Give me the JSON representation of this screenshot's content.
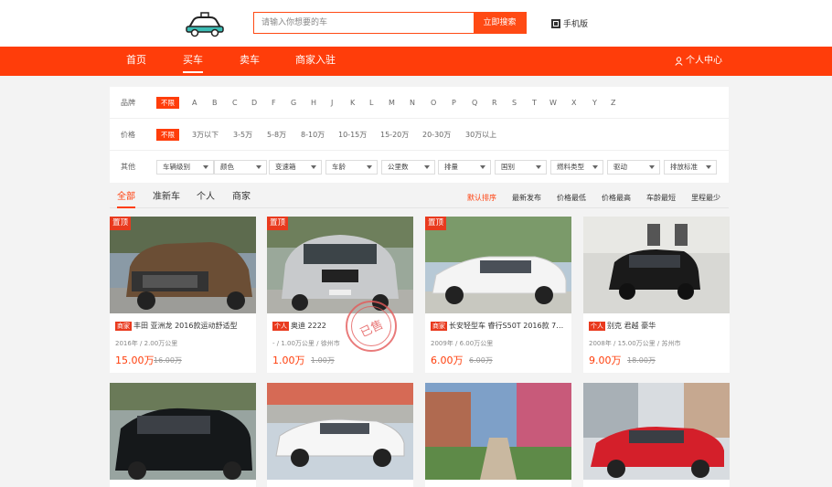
{
  "search": {
    "placeholder": "请输入你想要的车",
    "button": "立即搜索"
  },
  "header": {
    "mobile_label": "手机版"
  },
  "nav": {
    "items": [
      "首页",
      "买车",
      "卖车",
      "商家入驻"
    ],
    "user_center": "个人中心"
  },
  "filters": {
    "brand": {
      "label": "品牌",
      "selected": "不限",
      "letters": [
        "A",
        "B",
        "C",
        "D",
        "F",
        "G",
        "H",
        "J",
        "K",
        "L",
        "M",
        "N",
        "O",
        "P",
        "Q",
        "R",
        "S",
        "T",
        "W",
        "X",
        "Y",
        "Z"
      ]
    },
    "price": {
      "label": "价格",
      "selected": "不限",
      "options": [
        "3万以下",
        "3-5万",
        "5-8万",
        "8-10万",
        "10-15万",
        "15-20万",
        "20-30万",
        "30万以上"
      ]
    },
    "other": {
      "label": "其他",
      "selects": [
        "车辆级别",
        "颜色",
        "变速箱",
        "车龄",
        "公里数",
        "排量",
        "国别",
        "燃料类型",
        "驱动",
        "排放标准"
      ]
    }
  },
  "tabs": {
    "items": [
      "全部",
      "准新车",
      "个人",
      "商家"
    ]
  },
  "sort": {
    "items": [
      "默认排序",
      "最新发布",
      "价格最低",
      "价格最高",
      "车龄最短",
      "里程最少"
    ]
  },
  "cards": [
    {
      "pin": "置顶",
      "badge": "商家",
      "title": "丰田 亚洲龙 2016款运动舒适型",
      "meta": "2016年 / 2.00万公里",
      "price": "15.00万",
      "old_price": "16.00万"
    },
    {
      "pin": "置顶",
      "badge": "个人",
      "title": "奥迪 2222",
      "meta": "- / 1.00万公里 / 徐州市",
      "price": "1.00万",
      "old_price": "1.00万",
      "stamp": "已售"
    },
    {
      "pin": "置顶",
      "badge": "商家",
      "title": "长安轻型车 睿行S50T 2016款 740L...",
      "meta": "2009年 / 6.00万公里",
      "price": "6.00万",
      "old_price": "6.00万"
    },
    {
      "pin": "",
      "badge": "个人",
      "title": "别克 君越 豪华",
      "meta": "2008年 / 15.00万公里 / 苏州市",
      "price": "9.00万",
      "old_price": "18.00万"
    }
  ],
  "colors": {
    "accent": "#ff3d0a",
    "pin": "#e93a1e"
  }
}
